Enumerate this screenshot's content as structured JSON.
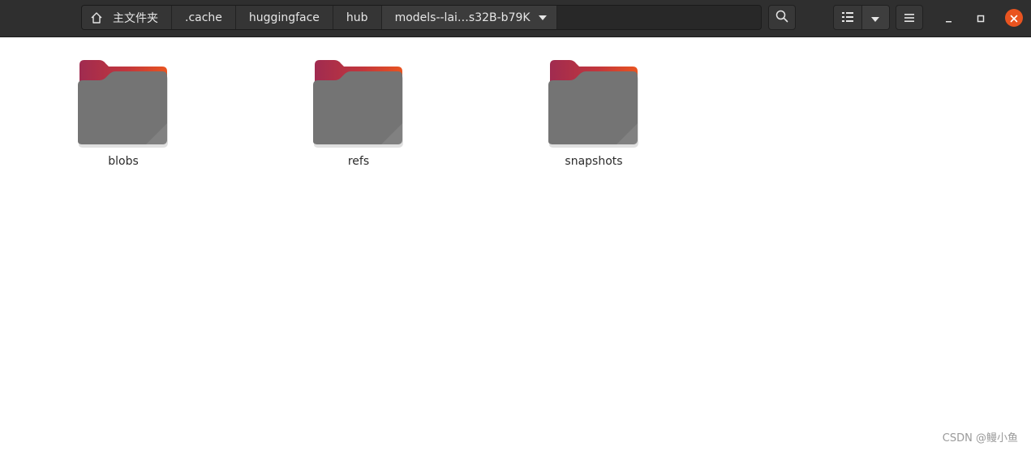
{
  "pathbar": {
    "home_label": "主文件夹",
    "crumbs": [
      ".cache",
      "huggingface",
      "hub"
    ],
    "current": "models--lai…s32B-b79K"
  },
  "toolbar": {
    "search_icon": "search-icon",
    "view_icon": "list-view-icon",
    "view_options_icon": "chevron-down-icon",
    "menu_icon": "hamburger-icon"
  },
  "window_controls": {
    "minimize_icon": "minimize-icon",
    "maximize_icon": "maximize-icon",
    "close_icon": "close-icon"
  },
  "folders": [
    {
      "name": "blobs"
    },
    {
      "name": "refs"
    },
    {
      "name": "snapshots"
    }
  ],
  "watermark": "CSDN @鳗小鱼",
  "colors": {
    "titlebar": "#2f2f2f",
    "accent": "#e95420",
    "folder_body": "#747474",
    "folder_tab_start": "#a02b50",
    "folder_tab_end": "#e95420"
  }
}
